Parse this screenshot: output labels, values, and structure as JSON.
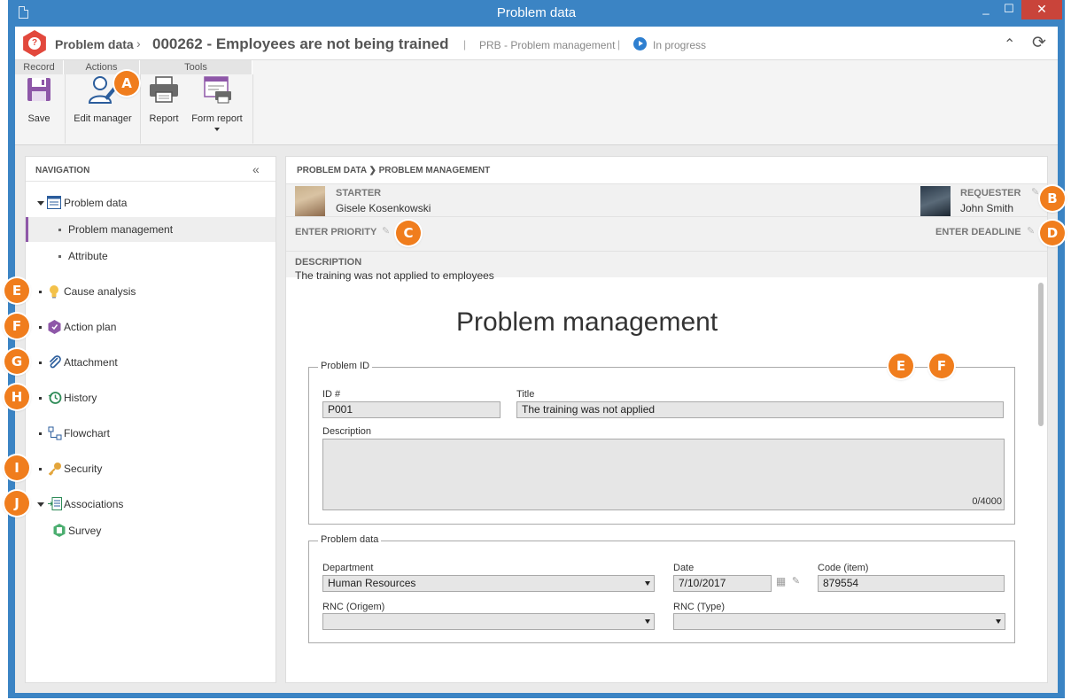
{
  "window": {
    "title": "Problem data",
    "minimize": "_",
    "maximize": "☐",
    "close": "✕"
  },
  "header": {
    "crumb1": "Problem data",
    "crumb_sep": "›",
    "crumb2": "000262 - Employees are not being trained",
    "sep": "|",
    "module": "PRB - Problem management",
    "status": "In progress",
    "collapse_glyph": "⌃",
    "refresh_glyph": "⟳"
  },
  "ribbon": {
    "groups": [
      "Record",
      "Actions",
      "Tools"
    ],
    "save": "Save",
    "edit_manager": "Edit manager",
    "report": "Report",
    "form_report": "Form report"
  },
  "nav": {
    "title": "NAVIGATION",
    "collapse_glyph": "«",
    "problem_data": "Problem data",
    "problem_management": "Problem management",
    "attribute": "Attribute",
    "cause_analysis": "Cause analysis",
    "action_plan": "Action plan",
    "attachment": "Attachment",
    "history": "History",
    "flowchart": "Flowchart",
    "security": "Security",
    "associations": "Associations",
    "survey": "Survey"
  },
  "main": {
    "breadcrumb": "PROBLEM DATA  ❯  PROBLEM MANAGEMENT",
    "starter_label": "STARTER",
    "starter_name": "Gisele Kosenkowski",
    "requester_label": "REQUESTER",
    "requester_name": "John Smith",
    "priority_label": "ENTER PRIORITY",
    "deadline_label": "ENTER DEADLINE",
    "description_label": "DESCRIPTION",
    "description_value": "The training was not applied to employees"
  },
  "form": {
    "title": "Problem management",
    "problem_id_legend": "Problem ID",
    "id_label": "ID #",
    "id_value": "P001",
    "title_label": "Title",
    "title_value": "The training was not applied",
    "description_label": "Description",
    "description_value": "",
    "char_count": "0/4000",
    "problem_data_legend": "Problem data",
    "department_label": "Department",
    "department_value": "Human Resources",
    "date_label": "Date",
    "date_value": "7/10/2017",
    "code_label": "Code (item)",
    "code_value": "879554",
    "rnc_origem_label": "RNC (Origem)",
    "rnc_origem_value": "",
    "rnc_type_label": "RNC (Type)",
    "rnc_type_value": ""
  },
  "callouts": {
    "A": "A",
    "B": "B",
    "C": "C",
    "D": "D",
    "E": "E",
    "F": "F",
    "G": "G",
    "H": "H",
    "I": "I",
    "J": "J"
  },
  "colors": {
    "titlebar": "#3b84c4",
    "close_button": "#c9443a",
    "callout": "#f07d1d",
    "selected_nav_accent": "#8e57a8",
    "status_icon": "#2e7fd0"
  }
}
